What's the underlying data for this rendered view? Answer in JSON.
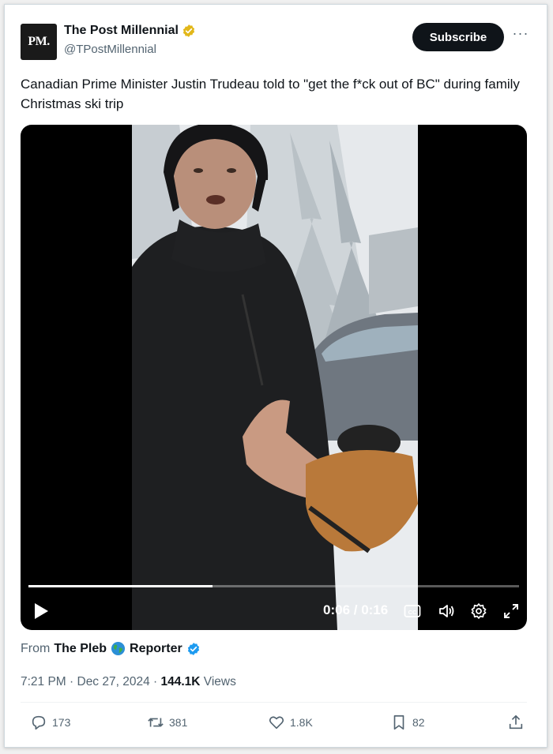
{
  "account": {
    "avatar_text": "PM.",
    "display_name": "The Post Millennial",
    "handle": "@TPostMillennial",
    "verified_badge": "gold-verified-badge-icon"
  },
  "subscribe_label": "Subscribe",
  "more_label": "···",
  "tweet": {
    "text": "Canadian Prime Minister Justin Trudeau told to \"get the f*ck out of BC\" during family Christmas ski trip"
  },
  "video": {
    "time_display": "0:06 / 0:16",
    "progress_fraction": 0.375,
    "controls": [
      "play-icon",
      "captions-icon",
      "volume-icon",
      "settings-icon",
      "fullscreen-icon"
    ]
  },
  "from": {
    "prefix": "From",
    "source_name_1": "The Pleb",
    "source_name_2": "Reporter"
  },
  "meta": {
    "timestamp": "7:21 PM · Dec 27, 2024 · ",
    "views_count": "144.1K",
    "views_label": " Views"
  },
  "actions": {
    "replies": "173",
    "reposts": "381",
    "likes": "1.8K",
    "bookmarks": "82"
  },
  "colors": {
    "subscribe_bg": "#0f1419",
    "verified_blue": "#1d9bf0",
    "verified_gold": "#e2b719",
    "muted_text": "#536471"
  }
}
